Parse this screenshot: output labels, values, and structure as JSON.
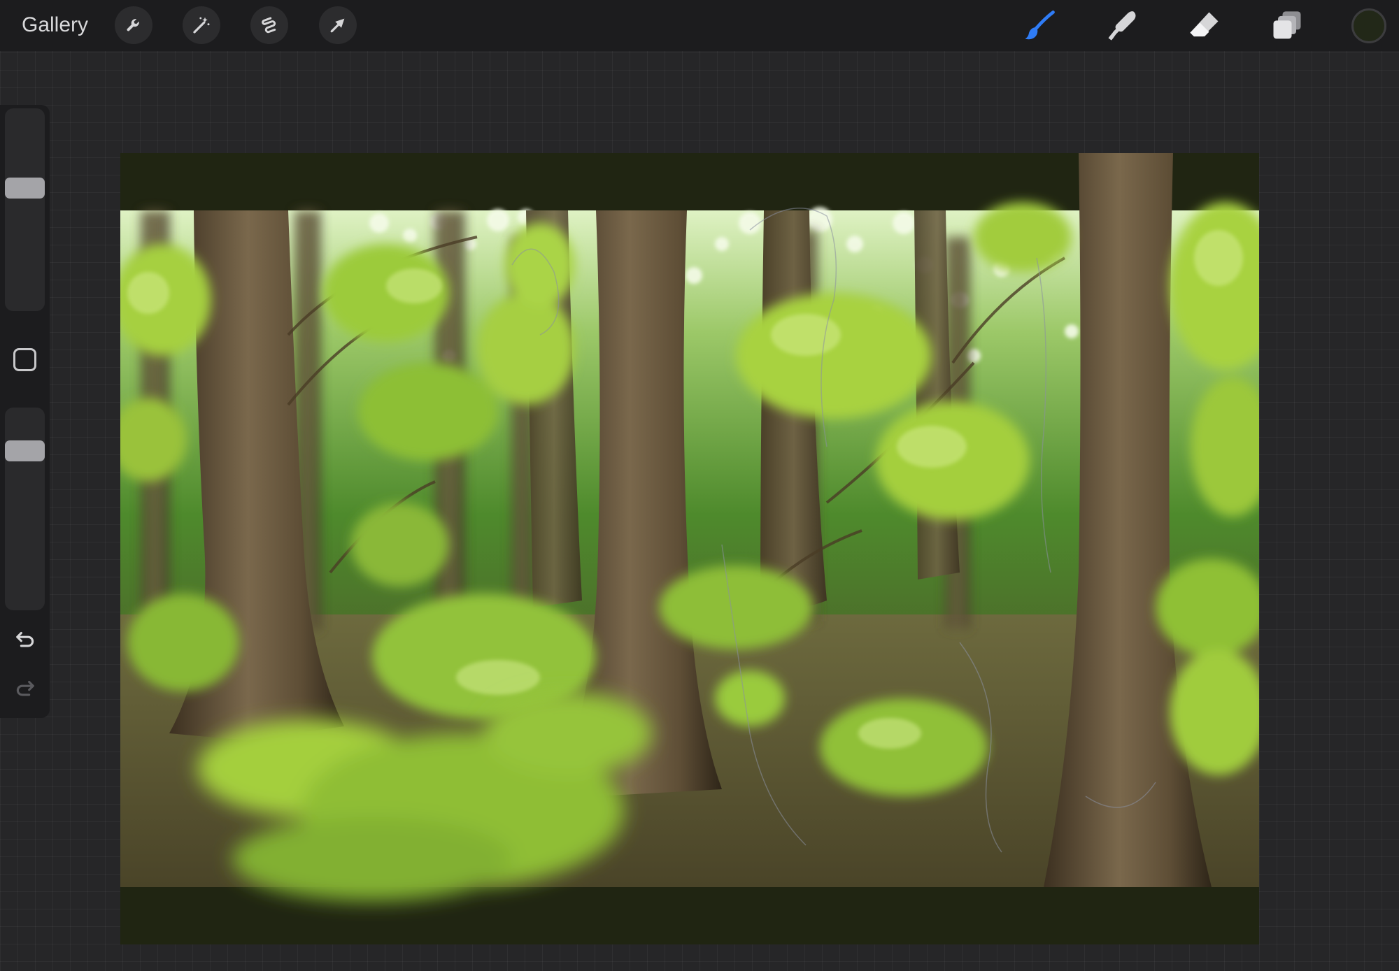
{
  "toolbar": {
    "gallery_label": "Gallery",
    "left_tools": [
      {
        "name": "actions",
        "icon": "wrench-icon"
      },
      {
        "name": "adjustments",
        "icon": "magic-wand-icon"
      },
      {
        "name": "selection",
        "icon": "selection-s-icon"
      },
      {
        "name": "transform",
        "icon": "arrow-cursor-icon"
      }
    ],
    "right_tools": [
      {
        "name": "brush",
        "icon": "brush-icon",
        "active": true
      },
      {
        "name": "smudge",
        "icon": "smudge-finger-icon",
        "active": false
      },
      {
        "name": "eraser",
        "icon": "eraser-icon",
        "active": false
      },
      {
        "name": "layers",
        "icon": "layers-icon",
        "active": false
      }
    ],
    "current_color": "#222818"
  },
  "sidebar": {
    "brush_size_level": 0.62,
    "brush_opacity_level": 0.82,
    "modify_icon": "square-icon",
    "undo_icon": "undo-icon",
    "redo_icon": "redo-icon"
  },
  "colors": {
    "accent": "#2f7cf6",
    "background": "#262628",
    "bar": "#1c1c1e",
    "canvas_border": "#202512"
  },
  "canvas": {
    "content": "painting-forest-scene"
  }
}
